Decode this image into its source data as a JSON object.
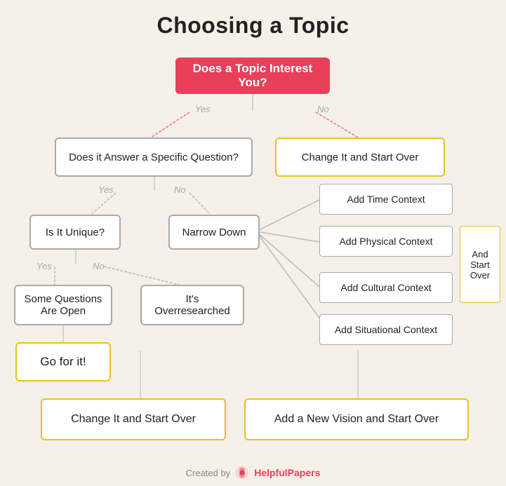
{
  "title": "Choosing a Topic",
  "nodes": {
    "start": "Does a Topic Interest You?",
    "question1": "Does it Answer a Specific Question?",
    "question2": "Is It Unique?",
    "narrow": "Narrow Down",
    "some_questions": "Some Questions Are Open",
    "overresearched": "It's Overresearched",
    "go_for_it": "Go for it!",
    "change_start_over_top": "Change It and Start Over",
    "change_start_over_bottom": "Change It and Start Over",
    "add_new_vision": "Add a New Vision and Start Over",
    "add_time": "Add Time Context",
    "add_physical": "Add Physical Context",
    "add_cultural": "Add Cultural Context",
    "add_situational": "Add Situational Context",
    "and_start_over": "And Start Over"
  },
  "labels": {
    "yes": "Yes",
    "no": "No"
  },
  "footer": {
    "created_by": "Created by",
    "brand": "HelpfulPapers"
  }
}
